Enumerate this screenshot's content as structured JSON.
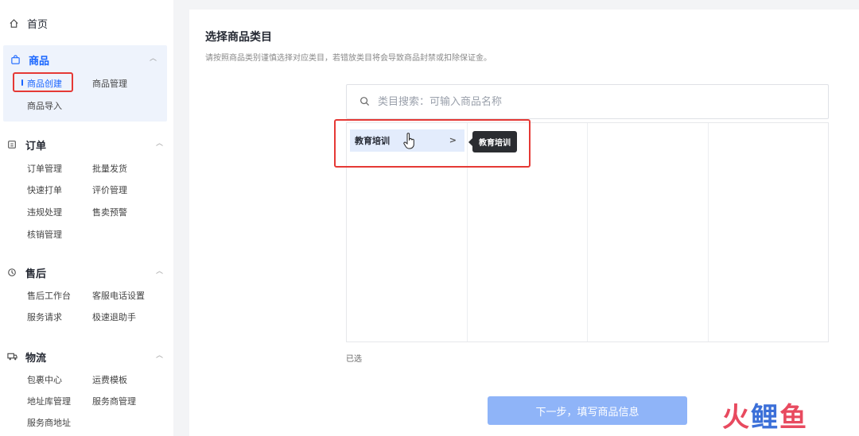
{
  "sidebar": {
    "home": {
      "icon": "home-icon",
      "label": "首页"
    },
    "sections": [
      {
        "icon": "shopping-bag-icon",
        "label": "商品",
        "items": [
          "商品创建",
          "商品管理",
          "商品导入"
        ],
        "current": "商品创建"
      },
      {
        "icon": "order-list-icon",
        "label": "订单",
        "items": [
          "订单管理",
          "批量发货",
          "快速打单",
          "评价管理",
          "违规处理",
          "售卖预警",
          "核销管理"
        ]
      },
      {
        "icon": "after-sale-icon",
        "label": "售后",
        "items": [
          "售后工作台",
          "客服电话设置",
          "服务请求",
          "极速退助手"
        ]
      },
      {
        "icon": "truck-icon",
        "label": "物流",
        "items": [
          "包裹中心",
          "运费模板",
          "地址库管理",
          "服务商管理",
          "服务商地址"
        ]
      }
    ]
  },
  "main": {
    "title": "选择商品类目",
    "description": "请按照商品类别谨慎选择对应类目，若错放类目将会导致商品封禁或扣除保证金。",
    "search_placeholder": "类目搜索：可输入商品名称",
    "category_selected": "教育培训",
    "tooltip": "教育培训",
    "selected_label": "已选",
    "next_button": "下一步，填写商品信息"
  },
  "watermark": {
    "part1": "火",
    "part2": "鲤",
    "part3": "鱼"
  },
  "colors": {
    "accent": "#1966ff",
    "highlight_red": "#e53935",
    "button_disabled": "#8fb4f8",
    "selected_bg": "#e3ecfc"
  }
}
